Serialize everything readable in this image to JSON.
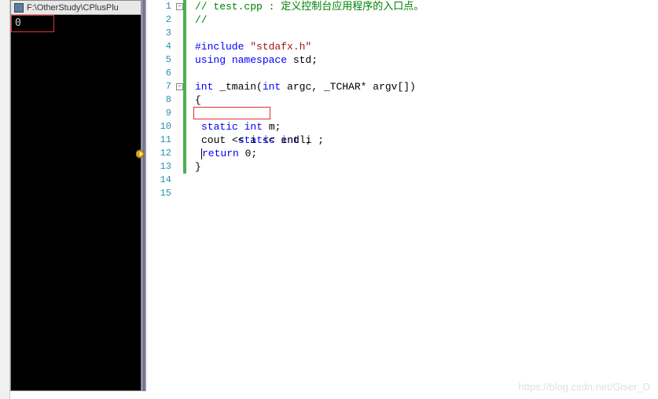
{
  "console": {
    "title": "F:\\OtherStudy\\CPlusPlu",
    "output": "0"
  },
  "editor": {
    "lines": [
      {
        "n": 1,
        "fold": "-",
        "change": true
      },
      {
        "n": 2,
        "change": true
      },
      {
        "n": 3,
        "change": true
      },
      {
        "n": 4,
        "change": true
      },
      {
        "n": 5,
        "change": true
      },
      {
        "n": 6,
        "change": true
      },
      {
        "n": 7,
        "fold": "-",
        "change": true
      },
      {
        "n": 8,
        "change": true
      },
      {
        "n": 9,
        "change": true
      },
      {
        "n": 10,
        "change": true
      },
      {
        "n": 11,
        "change": true
      },
      {
        "n": 12,
        "change": true,
        "bp": true
      },
      {
        "n": 13,
        "change": true
      },
      {
        "n": 14
      },
      {
        "n": 15
      }
    ],
    "tokens": {
      "l1_comment": "// test.cpp : 定义控制台应用程序的入口点。",
      "l2_comment": "//",
      "l4_include": "#include ",
      "l4_str": "\"stdafx.h\"",
      "l5_using": "using",
      "l5_ns": " namespace",
      "l5_std": " std;",
      "l7_int": "int",
      "l7_tmain": " _tmain(",
      "l7_int2": "int",
      "l7_argc": " argc, _TCHAR* argv[])",
      "l8_brace": "{",
      "l9_static": "static",
      "l9_int": " int",
      "l9_i": " i ;",
      "l10_static": "static",
      "l10_int": " int",
      "l10_m": " m;",
      "l11_cout": "cout << i << endl;",
      "l12_return": "return",
      "l12_zero": " 0;",
      "l13_brace": "}"
    }
  },
  "watermark": "https://blog.csdn.net/Giser_D"
}
